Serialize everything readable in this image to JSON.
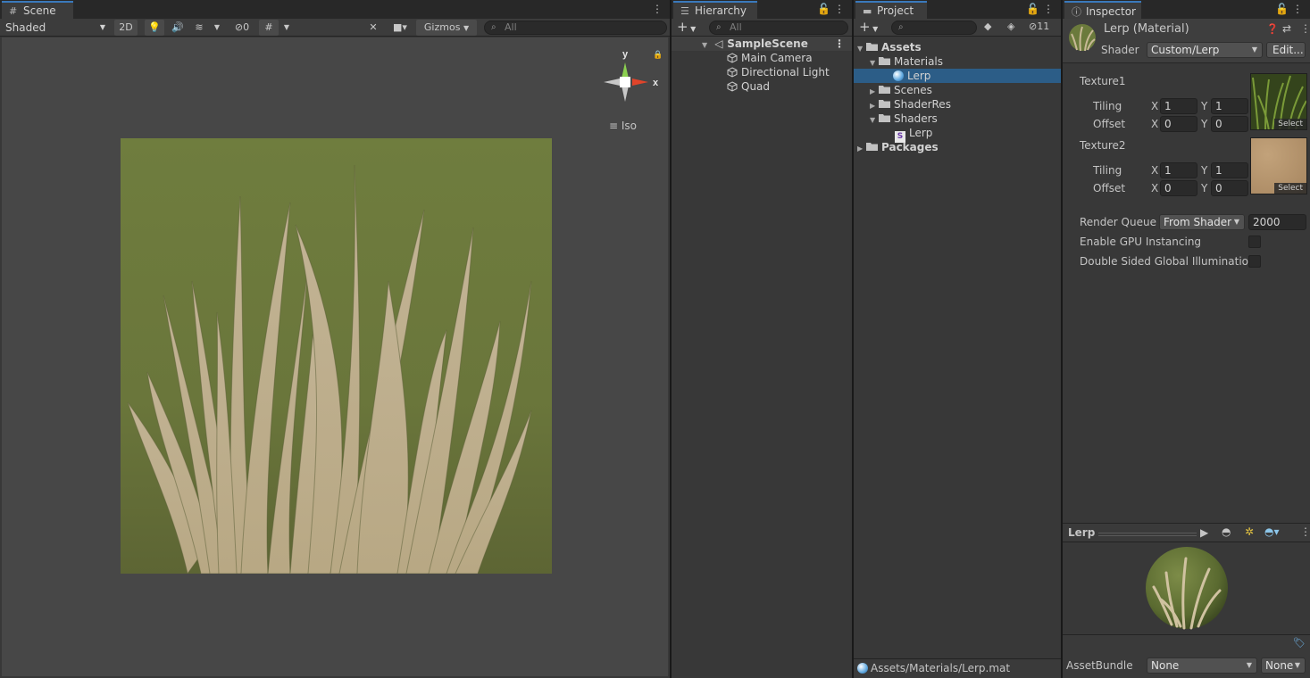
{
  "scene": {
    "tab_label": "Scene",
    "shading_mode": "Shaded",
    "mode_2d": "2D",
    "hidden_count": "0",
    "gizmos_label": "Gizmos",
    "search_placeholder": "All",
    "gizmo_y": "y",
    "gizmo_x": "x",
    "projection": "Iso"
  },
  "hierarchy": {
    "tab_label": "Hierarchy",
    "search_placeholder": "All",
    "scene_name": "SampleScene",
    "items": [
      {
        "label": "Main Camera"
      },
      {
        "label": "Directional Light"
      },
      {
        "label": "Quad"
      }
    ]
  },
  "project": {
    "tab_label": "Project",
    "hidden_count": "11",
    "tree": {
      "assets": "Assets",
      "materials": "Materials",
      "lerp_material": "Lerp",
      "scenes": "Scenes",
      "shaderres": "ShaderRes",
      "shaders": "Shaders",
      "lerp_shader": "Lerp",
      "packages": "Packages"
    },
    "footer_path": "Assets/Materials/Lerp.mat"
  },
  "inspector": {
    "tab_label": "Inspector",
    "title": "Lerp (Material)",
    "shader_label": "Shader",
    "shader_value": "Custom/Lerp",
    "edit_label": "Edit...",
    "texture1": {
      "label": "Texture1",
      "tiling_label": "Tiling",
      "offset_label": "Offset",
      "tiling_x": "1",
      "tiling_y": "1",
      "offset_x": "0",
      "offset_y": "0",
      "select_label": "Select"
    },
    "texture2": {
      "label": "Texture2",
      "tiling_label": "Tiling",
      "offset_label": "Offset",
      "tiling_x": "1",
      "tiling_y": "1",
      "offset_x": "0",
      "offset_y": "0",
      "select_label": "Select"
    },
    "axis_x": "X",
    "axis_y": "Y",
    "render_queue_label": "Render Queue",
    "render_queue_mode": "From Shader",
    "render_queue_value": "2000",
    "gpu_instancing_label": "Enable GPU Instancing",
    "gpu_instancing_checked": false,
    "double_sided_gi_label": "Double Sided Global Illumination",
    "double_sided_gi_checked": false,
    "preview_title": "Lerp",
    "assetbundle_label": "AssetBundle",
    "assetbundle_value": "None",
    "assetbundle_variant": "None"
  },
  "colors": {
    "accent": "#3a79bb",
    "selection": "#2c5d87",
    "grass_bg": "#6e7d3e",
    "blade": "#c7b898"
  }
}
